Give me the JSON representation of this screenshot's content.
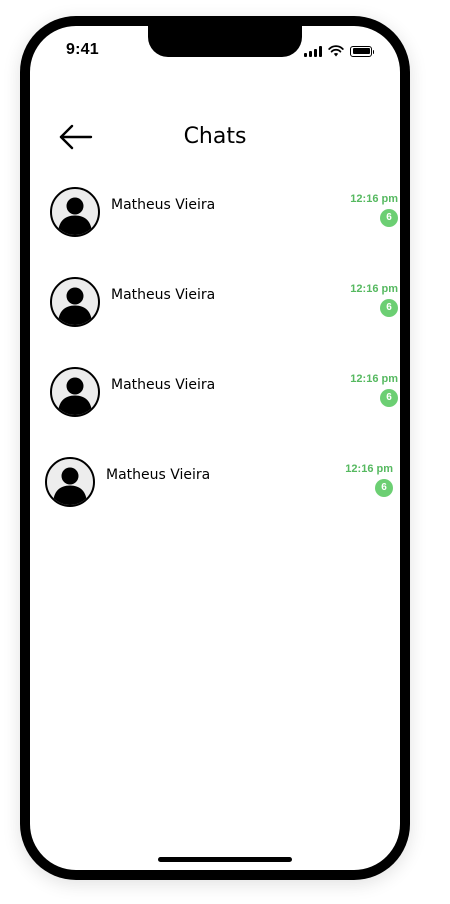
{
  "status_bar": {
    "time": "9:41"
  },
  "header": {
    "title": "Chats"
  },
  "chats": [
    {
      "name": "Matheus Vieira",
      "time": "12:16 pm",
      "unread": "6"
    },
    {
      "name": "Matheus Vieira",
      "time": "12:16 pm",
      "unread": "6"
    },
    {
      "name": "Matheus Vieira",
      "time": "12:16 pm",
      "unread": "6"
    },
    {
      "name": "Matheus Vieira",
      "time": "12:16 pm",
      "unread": "6"
    }
  ],
  "colors": {
    "accent_text": "#56b960",
    "badge_bg": "#6ccf73"
  },
  "icons": {
    "back": "arrow-left-icon",
    "avatar": "user-avatar-icon",
    "signal": "cellular-signal-icon",
    "wifi": "wifi-icon",
    "battery": "battery-icon"
  }
}
